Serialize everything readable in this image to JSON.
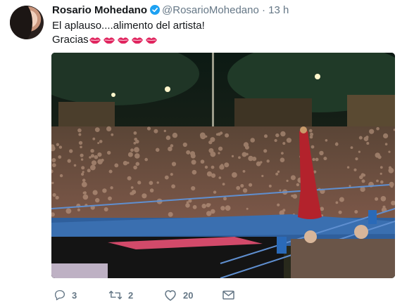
{
  "tweet": {
    "name": "Rosario Mohedano",
    "handle": "@RosarioMohedano",
    "separator": "·",
    "time": "13 h",
    "text_line1": "El aplauso....alimento del artista!",
    "text_line2": "Gracias"
  },
  "actions": {
    "replies": "3",
    "retweets": "2",
    "likes": "20"
  },
  "icons": {
    "verified": "verified-badge-icon",
    "kiss": "kiss-mark-emoji",
    "reply": "reply-icon",
    "retweet": "retweet-icon",
    "like": "heart-icon",
    "dm": "direct-message-icon"
  },
  "colors": {
    "accent": "#1da1f2",
    "muted": "#657786",
    "text": "#14171a",
    "kiss": "#e0245e"
  }
}
